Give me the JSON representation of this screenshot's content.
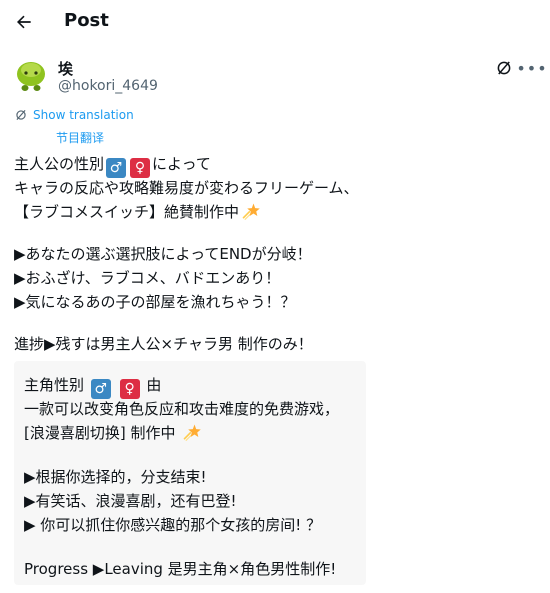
{
  "header": {
    "title": "Post"
  },
  "author": {
    "name": "埃",
    "handle": "@hokori_4649"
  },
  "translate": {
    "show_label": "Show translation",
    "sub_label": "节目翻译"
  },
  "tweet": {
    "l1_pre": "主人公の性別",
    "l1_male": "♂",
    "l1_female": "♀",
    "l1_post": "によって",
    "l2": "キャラの反応や攻略難易度が変わるフリーゲーム、",
    "l3": "【ラブコメスイッチ】絶賛制作中",
    "l4": "▶あなたの選ぶ選択肢によってENDが分岐！",
    "l5": "▶おふざけ、ラブコメ、バドエンあり！",
    "l6": "▶気になるあの子の部屋を漁れちゃう！？",
    "l7": "進捗▶残すは男主人公×チャラ男 制作のみ！"
  },
  "translation": {
    "l1_pre": "主角性别",
    "l1_male": "♂",
    "l1_female": "♀",
    "l1_post": "由",
    "l2": "一款可以改变角色反应和攻击难度的免费游戏，",
    "l3": "[浪漫喜剧切换] 制作中",
    "l4": "▶根据你选择的，分支结束!",
    "l5": "▶有笑话、浪漫喜剧，还有巴登!",
    "l6": "▶ 你可以抓住你感兴趣的那个女孩的房间! ？",
    "l7": "Progress ▶Leaving 是男主角×角色男性制作!"
  },
  "colors": {
    "accent": "#1d9bf0",
    "male": "#3b88c3",
    "female": "#dd2e44",
    "secondary_text": "#536471"
  }
}
